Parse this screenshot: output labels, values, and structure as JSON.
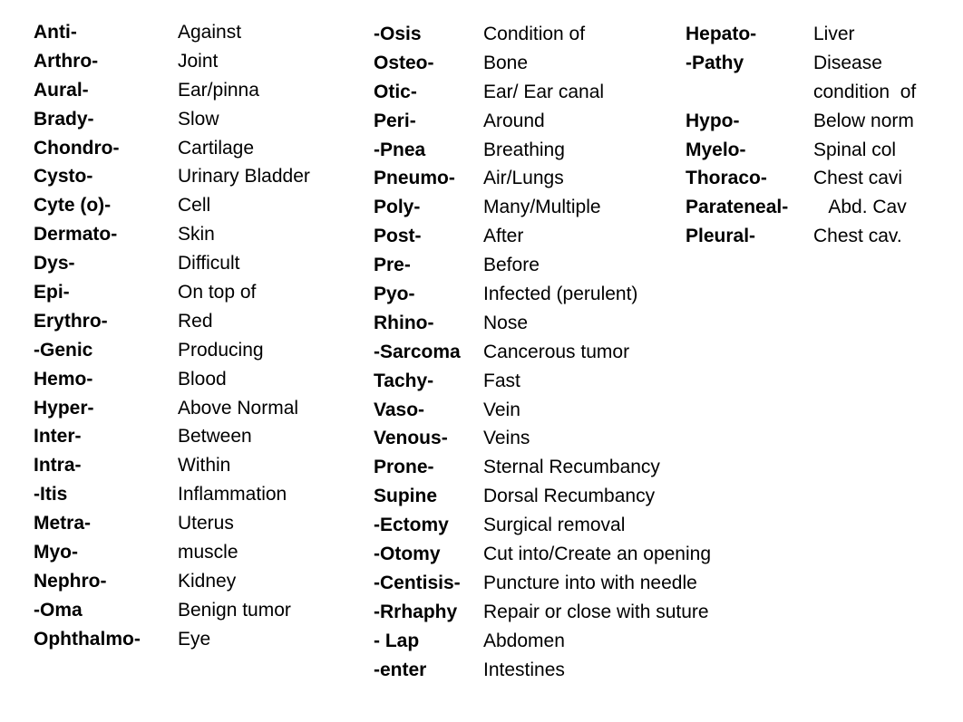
{
  "columns": [
    {
      "rows": [
        {
          "term": "Anti-",
          "definition": "Against"
        },
        {
          "term": "Arthro-",
          "definition": "Joint"
        },
        {
          "term": "Aural-",
          "definition": "Ear/pinna"
        },
        {
          "term": "Brady-",
          "definition": "Slow"
        },
        {
          "term": "Chondro-",
          "definition": "Cartilage"
        },
        {
          "term": "Cysto-",
          "definition": "Urinary Bladder"
        },
        {
          "term": "Cyte (o)-",
          "definition": "Cell"
        },
        {
          "term": "Dermato-",
          "definition": "Skin"
        },
        {
          "term": "Dys-",
          "definition": "Difficult"
        },
        {
          "term": "Epi-",
          "definition": "On top of"
        },
        {
          "term": "Erythro-",
          "definition": "Red"
        },
        {
          "term": "-Genic",
          "definition": "Producing"
        },
        {
          "term": "Hemo-",
          "definition": "Blood"
        },
        {
          "term": "Hyper-",
          "definition": "Above Normal"
        },
        {
          "term": "Inter-",
          "definition": "Between"
        },
        {
          "term": "Intra-",
          "definition": "Within"
        },
        {
          "term": "-Itis",
          "definition": "Inflammation"
        },
        {
          "term": "Metra-",
          "definition": "Uterus"
        },
        {
          "term": "Myo-",
          "definition": "muscle"
        },
        {
          "term": "Nephro-",
          "definition": "Kidney"
        },
        {
          "term": "-Oma",
          "definition": "Benign tumor"
        },
        {
          "term": "Ophthalmo-",
          "definition": "Eye"
        }
      ]
    },
    {
      "rows": [
        {
          "term": "-Osis",
          "definition": "Condition of"
        },
        {
          "term": "Osteo-",
          "definition": "Bone"
        },
        {
          "term": "Otic-",
          "definition": "Ear/ Ear canal"
        },
        {
          "term": "Peri-",
          "definition": "Around"
        },
        {
          "term": "-Pnea",
          "definition": "Breathing"
        },
        {
          "term": "Pneumo-",
          "definition": "Air/Lungs"
        },
        {
          "term": "Poly-",
          "definition": "Many/Multiple"
        },
        {
          "term": "Post-",
          "definition": "After"
        },
        {
          "term": "Pre-",
          "definition": "Before"
        },
        {
          "term": "Pyo-",
          "definition": "Infected (perulent)"
        },
        {
          "term": "Rhino-",
          "definition": "Nose"
        },
        {
          "term": "-Sarcoma",
          "definition": "Cancerous tumor"
        },
        {
          "term": "Tachy-",
          "definition": "Fast"
        },
        {
          "term": "Vaso-",
          "definition": "Vein"
        },
        {
          "term": "Venous-",
          "definition": "Veins"
        },
        {
          "term": "Prone-",
          "definition": "Sternal Recumbancy"
        },
        {
          "term": "Supine",
          "definition": "Dorsal Recumbancy"
        },
        {
          "term": "-Ectomy",
          "definition": "Surgical removal"
        },
        {
          "term": "-Otomy",
          "definition": "Cut into/Create an opening"
        },
        {
          "term": "-Centisis-",
          "definition": "Puncture into with needle"
        },
        {
          "term": "-Rrhaphy",
          "definition": "Repair or close with suture"
        },
        {
          "term": "- Lap",
          "definition": "Abdomen"
        },
        {
          "term": "-enter",
          "definition": "Intestines"
        }
      ]
    },
    {
      "rows": [
        {
          "term": "Hepato-",
          "definition": "Liver"
        },
        {
          "term": "-Pathy",
          "definition": "Disease"
        },
        {
          "term": "",
          "definition": "condition  of"
        },
        {
          "term": "Hypo-",
          "definition": "Below norm"
        },
        {
          "term": "Myelo-",
          "definition": "Spinal col"
        },
        {
          "term": "Thoraco-",
          "definition": "Chest cavi"
        },
        {
          "term": "Parateneal-",
          "definition": "   Abd. Cav"
        },
        {
          "term": "Pleural-",
          "definition": "Chest cav."
        }
      ]
    }
  ]
}
